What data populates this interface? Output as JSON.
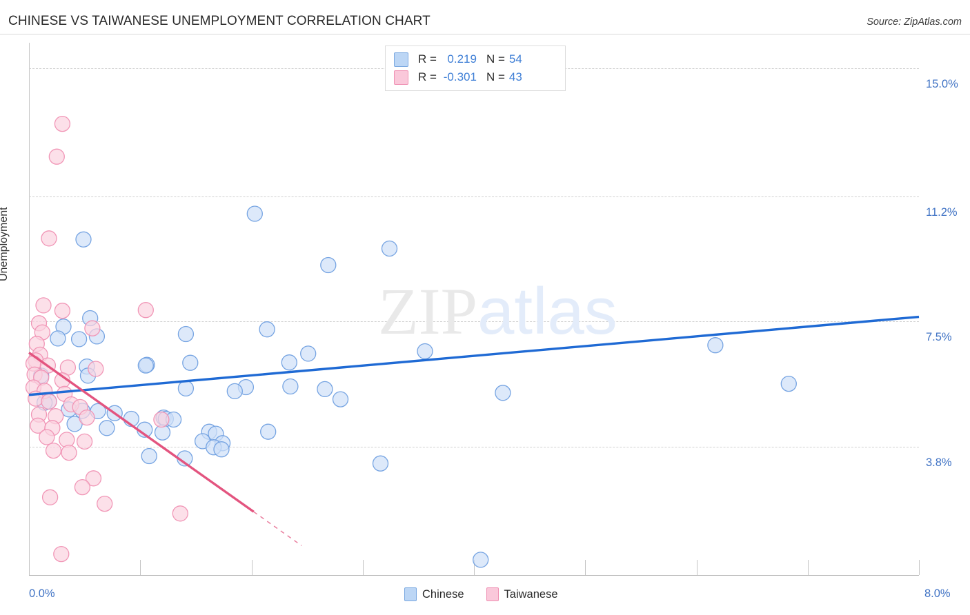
{
  "header": {
    "title": "CHINESE VS TAIWANESE UNEMPLOYMENT CORRELATION CHART",
    "source": "Source: ZipAtlas.com"
  },
  "watermark": {
    "part1": "ZIP",
    "part2": "atlas"
  },
  "stats": {
    "rows": [
      {
        "series": "Chinese",
        "r_label": "R =",
        "r_value": "0.219",
        "n_label": "N =",
        "n_value": "54",
        "color": "#bcd6f5"
      },
      {
        "series": "Taiwanese",
        "r_label": "R =",
        "r_value": "-0.301",
        "n_label": "N =",
        "n_value": "43",
        "color": "#fac8da"
      }
    ]
  },
  "legend": {
    "items": [
      {
        "label": "Chinese",
        "color": "#bcd6f5",
        "border": "#7aa8e0"
      },
      {
        "label": "Taiwanese",
        "color": "#fac8da",
        "border": "#ef8fb2"
      }
    ]
  },
  "axes": {
    "y_title": "Unemployment",
    "y_ticks": [
      "15.0%",
      "11.2%",
      "7.5%",
      "3.8%"
    ],
    "x_min_label": "0.0%",
    "x_max_label": "8.0%"
  },
  "chart_data": {
    "type": "scatter",
    "title": "CHINESE VS TAIWANESE UNEMPLOYMENT CORRELATION CHART",
    "xlabel": "",
    "ylabel": "Unemployment",
    "xlim": [
      0.0,
      8.0
    ],
    "ylim": [
      0.0,
      15.75
    ],
    "x_tick_labels": [
      "0.0%",
      "8.0%"
    ],
    "y_tick_values": [
      15.0,
      11.2,
      7.5,
      3.8
    ],
    "y_tick_labels": [
      "15.0%",
      "11.2%",
      "7.5%",
      "3.8%"
    ],
    "grid": true,
    "legend_position": "bottom-center",
    "series": [
      {
        "name": "Chinese",
        "color": "#cfe0f8",
        "border": "#6f9fe0",
        "R": 0.219,
        "N": 54,
        "trendline": {
          "x0": 0.0,
          "y0": 5.33,
          "x1": 8.0,
          "y1": 7.64,
          "color": "#1f6ad4",
          "dashed_from": null
        },
        "points": [
          [
            0.49,
            9.93
          ],
          [
            2.03,
            10.69
          ],
          [
            3.24,
            9.66
          ],
          [
            2.69,
            9.17
          ],
          [
            1.41,
            7.13
          ],
          [
            2.14,
            7.27
          ],
          [
            0.55,
            7.6
          ],
          [
            0.31,
            7.35
          ],
          [
            0.61,
            7.06
          ],
          [
            0.26,
            7.0
          ],
          [
            0.45,
            6.98
          ],
          [
            2.51,
            6.55
          ],
          [
            3.56,
            6.62
          ],
          [
            6.17,
            6.8
          ],
          [
            2.34,
            6.29
          ],
          [
            1.06,
            6.22
          ],
          [
            1.05,
            6.2
          ],
          [
            1.45,
            6.28
          ],
          [
            0.52,
            6.17
          ],
          [
            0.11,
            5.9
          ],
          [
            0.53,
            5.9
          ],
          [
            1.41,
            5.52
          ],
          [
            1.95,
            5.56
          ],
          [
            2.35,
            5.58
          ],
          [
            1.85,
            5.44
          ],
          [
            2.66,
            5.5
          ],
          [
            4.26,
            5.39
          ],
          [
            6.83,
            5.66
          ],
          [
            2.8,
            5.2
          ],
          [
            0.18,
            5.14
          ],
          [
            0.14,
            5.1
          ],
          [
            0.36,
            4.9
          ],
          [
            0.48,
            4.86
          ],
          [
            0.62,
            4.85
          ],
          [
            0.77,
            4.79
          ],
          [
            0.92,
            4.62
          ],
          [
            1.21,
            4.66
          ],
          [
            1.23,
            4.62
          ],
          [
            1.3,
            4.6
          ],
          [
            0.41,
            4.47
          ],
          [
            0.7,
            4.35
          ],
          [
            1.04,
            4.3
          ],
          [
            1.2,
            4.22
          ],
          [
            1.62,
            4.24
          ],
          [
            1.68,
            4.18
          ],
          [
            2.15,
            4.24
          ],
          [
            1.56,
            3.96
          ],
          [
            1.74,
            3.9
          ],
          [
            1.66,
            3.78
          ],
          [
            1.08,
            3.52
          ],
          [
            1.4,
            3.45
          ],
          [
            3.16,
            3.3
          ],
          [
            1.73,
            3.72
          ],
          [
            4.06,
            0.45
          ]
        ]
      },
      {
        "name": "Taiwanese",
        "color": "#fbd3e0",
        "border": "#f091b3",
        "R": -0.301,
        "N": 43,
        "trendline": {
          "x0": 0.0,
          "y0": 6.58,
          "x1": 2.45,
          "y1": 0.87,
          "color": "#e3547f",
          "dashed_from": 2.02
        },
        "points": [
          [
            0.3,
            13.35
          ],
          [
            0.25,
            12.38
          ],
          [
            0.18,
            9.96
          ],
          [
            1.05,
            7.84
          ],
          [
            0.13,
            7.98
          ],
          [
            0.3,
            7.82
          ],
          [
            0.57,
            7.3
          ],
          [
            0.09,
            7.45
          ],
          [
            0.12,
            7.18
          ],
          [
            0.07,
            6.84
          ],
          [
            0.1,
            6.52
          ],
          [
            0.06,
            6.35
          ],
          [
            0.04,
            6.26
          ],
          [
            0.17,
            6.2
          ],
          [
            0.35,
            6.14
          ],
          [
            0.6,
            6.1
          ],
          [
            0.05,
            5.93
          ],
          [
            0.11,
            5.84
          ],
          [
            0.3,
            5.76
          ],
          [
            0.04,
            5.55
          ],
          [
            0.14,
            5.45
          ],
          [
            0.32,
            5.36
          ],
          [
            0.06,
            5.22
          ],
          [
            0.18,
            5.13
          ],
          [
            0.38,
            5.05
          ],
          [
            0.46,
            4.97
          ],
          [
            0.09,
            4.75
          ],
          [
            0.24,
            4.7
          ],
          [
            0.52,
            4.66
          ],
          [
            1.19,
            4.6
          ],
          [
            0.08,
            4.42
          ],
          [
            0.21,
            4.35
          ],
          [
            0.16,
            4.08
          ],
          [
            0.34,
            4.0
          ],
          [
            0.5,
            3.95
          ],
          [
            0.22,
            3.68
          ],
          [
            0.36,
            3.62
          ],
          [
            0.58,
            2.86
          ],
          [
            0.48,
            2.6
          ],
          [
            0.19,
            2.3
          ],
          [
            0.68,
            2.11
          ],
          [
            1.36,
            1.82
          ],
          [
            0.29,
            0.62
          ]
        ]
      }
    ]
  }
}
